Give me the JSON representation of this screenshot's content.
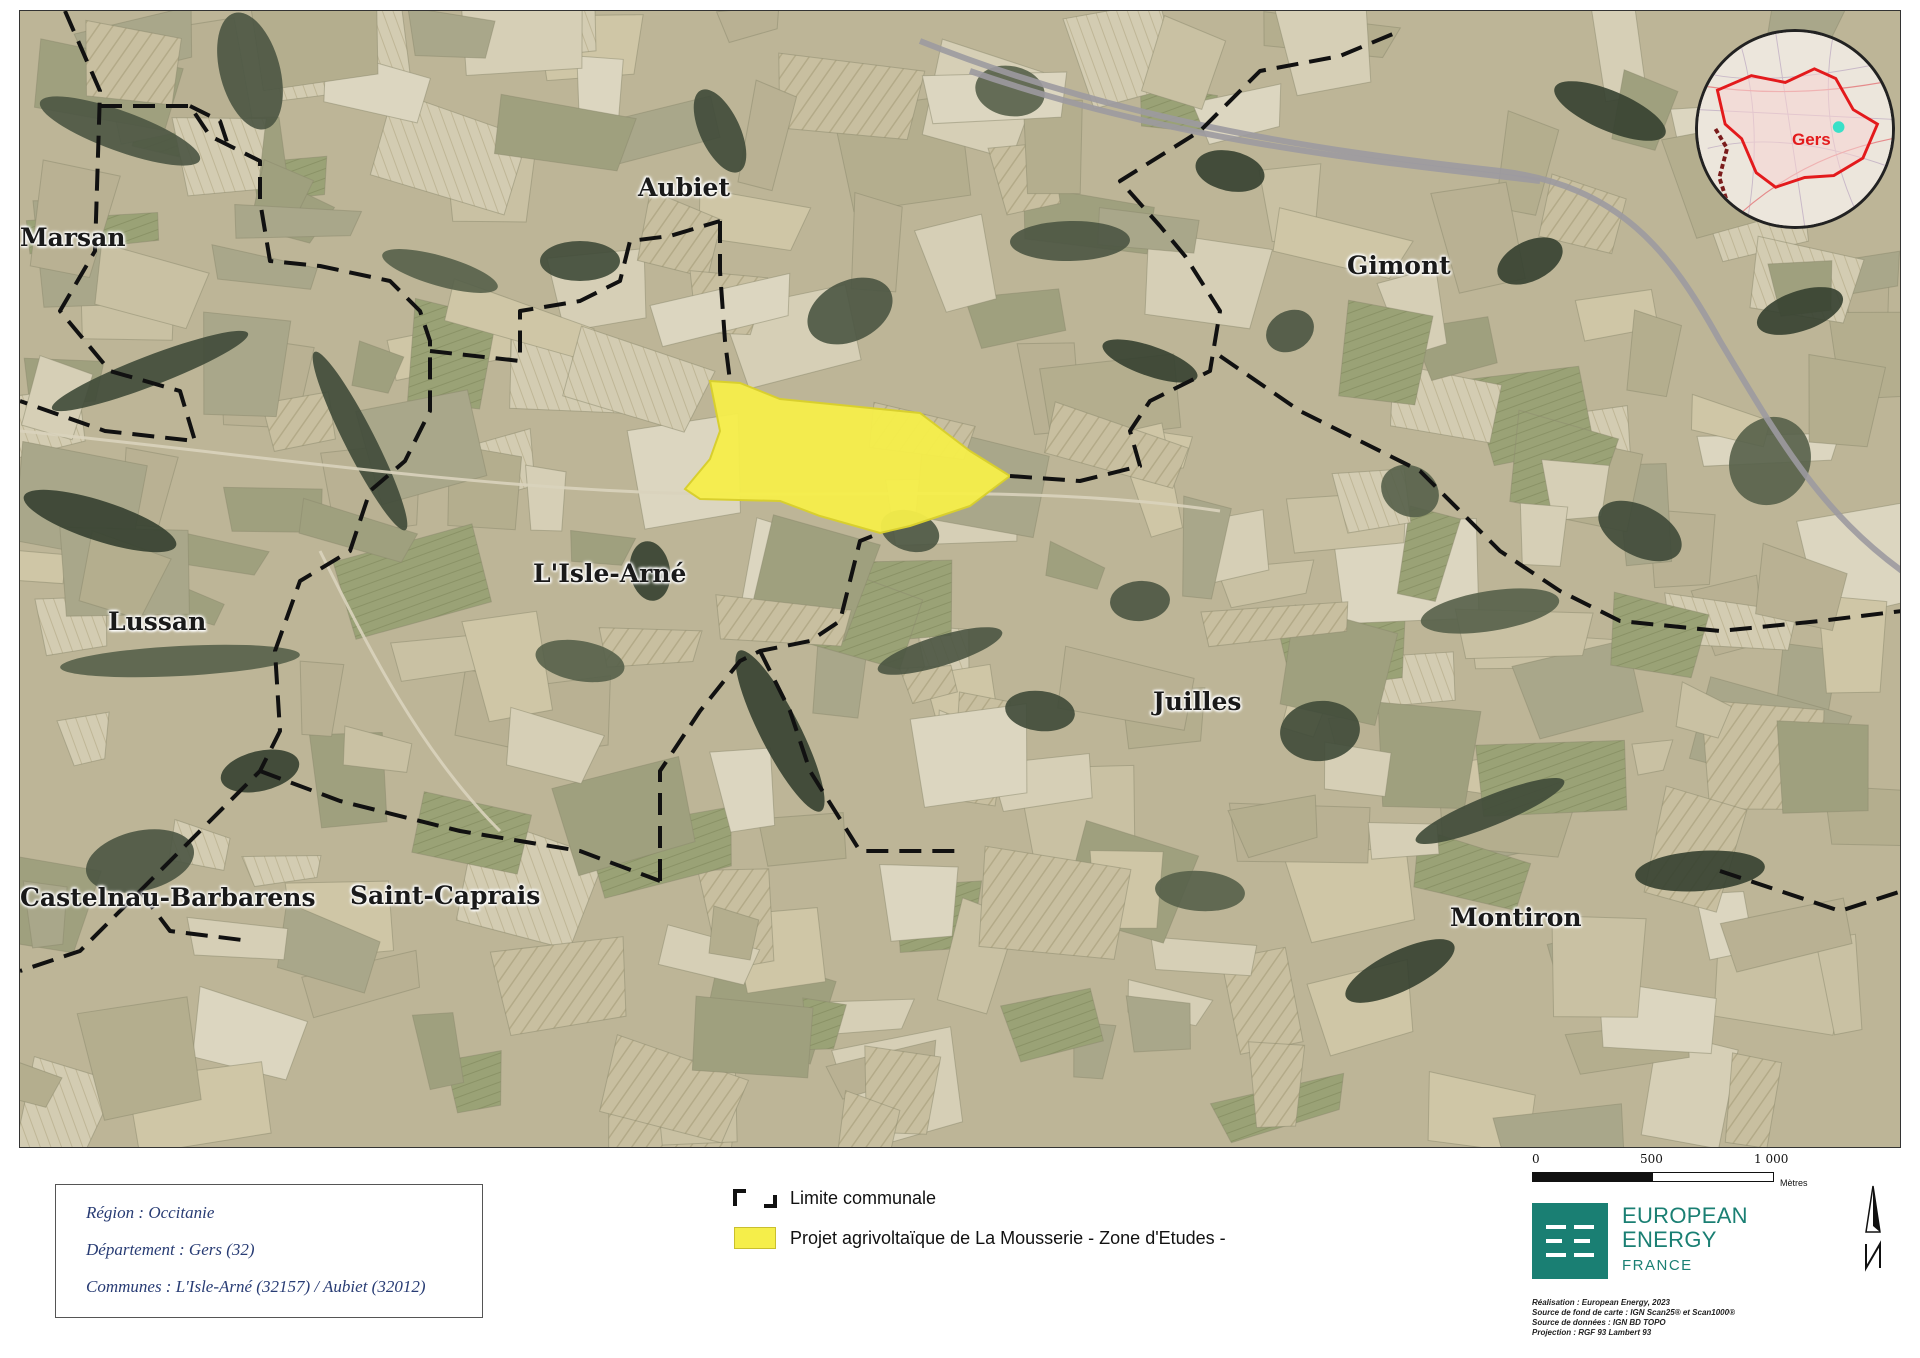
{
  "map": {
    "places": [
      {
        "id": "aubiet",
        "name": "Aubiet"
      },
      {
        "id": "marsan",
        "name": "Marsan"
      },
      {
        "id": "gimont",
        "name": "Gimont"
      },
      {
        "id": "isle-arne",
        "name": "L'Isle-Arné"
      },
      {
        "id": "lussan",
        "name": "Lussan"
      },
      {
        "id": "juilles",
        "name": "Juilles"
      },
      {
        "id": "castelnau",
        "name": "Castelnau-Barbarens"
      },
      {
        "id": "saint-caprais",
        "name": "Saint-Caprais"
      },
      {
        "id": "montiron",
        "name": "Montiron"
      }
    ],
    "colors": {
      "project_zone": "#f5ee4a",
      "boundary": "#111111",
      "inset_outline": "#e31a1c",
      "inset_marker": "#39e0c8"
    }
  },
  "inset": {
    "label": "Gers",
    "top_text": "...",
    "marker_icon": "location-dot-icon"
  },
  "info": {
    "region": "Région : Occitanie",
    "departement": "Département : Gers (32)",
    "communes": "Communes : L'Isle-Arné (32157) / Aubiet (32012)"
  },
  "legend": {
    "boundary_label": "Limite communale",
    "project_label": "Projet agrivoltaïque de La Mousserie - Zone d'Etudes -"
  },
  "scale": {
    "ticks": [
      "0",
      "500",
      "1 000"
    ],
    "unit": "Mètres"
  },
  "logo": {
    "line1": "EUROPEAN",
    "line2": "ENERGY",
    "line3": "FRANCE"
  },
  "credits": [
    "Réalisation : European Energy, 2023",
    "Source de fond de carte : IGN Scan25® et Scan1000®",
    "Source de données : IGN BD TOPO",
    "Projection : RGF 93 Lambert 93"
  ],
  "north": {
    "icon": "north-arrow-icon"
  }
}
